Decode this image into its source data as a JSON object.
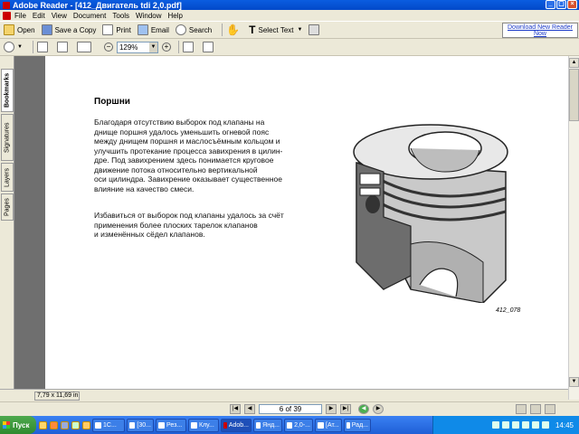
{
  "window": {
    "title": "Adobe Reader - [412_Двигатель tdi 2,0.pdf]"
  },
  "menu": [
    "File",
    "Edit",
    "View",
    "Document",
    "Tools",
    "Window",
    "Help"
  ],
  "toolbar": {
    "open_label": "Open",
    "save_copy_label": "Save a Copy",
    "print_label": "Print",
    "email_label": "Email",
    "search_label": "Search",
    "select_text_label": "Select Text",
    "download_link": "Download New Reader Now"
  },
  "zoom": {
    "value": "129%"
  },
  "nav_tabs": {
    "bookmarks": "Bookmarks",
    "signatures": "Signatures",
    "layers": "Layers",
    "pages": "Pages"
  },
  "document": {
    "heading": "Поршни",
    "paragraph1_lines": [
      "Благодаря отсутствию выборок под клапаны на",
      "днище поршня удалось уменьшить огневой пояс",
      "между днищем поршня и маслосъёмным кольцом и",
      "улучшить протекание процесса завихрения в цилин-",
      "дре. Под завихрением здесь понимается круговое",
      "движение потока относительно вертикальной",
      "оси цилиндра. Завихрение оказывает существенное",
      "влияние на качество смеси."
    ],
    "paragraph2_lines": [
      "Избавиться от выборок под клапаны удалось за счёт",
      "применения более плоских тарелок клапанов",
      "и изменённых сёдел клапанов."
    ],
    "figure_caption": "412_078"
  },
  "status": {
    "page_size": "7,79 x 11,69 in",
    "page_indicator": "6 of 39"
  },
  "taskbar": {
    "start_label": "Пуск",
    "tasks": [
      "1С...",
      "[30...",
      "Рез...",
      "Клу...",
      "Adob...",
      "Янд...",
      "2,0-...",
      "[Ат...",
      "Рад..."
    ],
    "clock": "14:45"
  },
  "colors": {
    "titlebar": "#0a5de0",
    "taskbar": "#245edb",
    "start": "#3a9a3a"
  }
}
